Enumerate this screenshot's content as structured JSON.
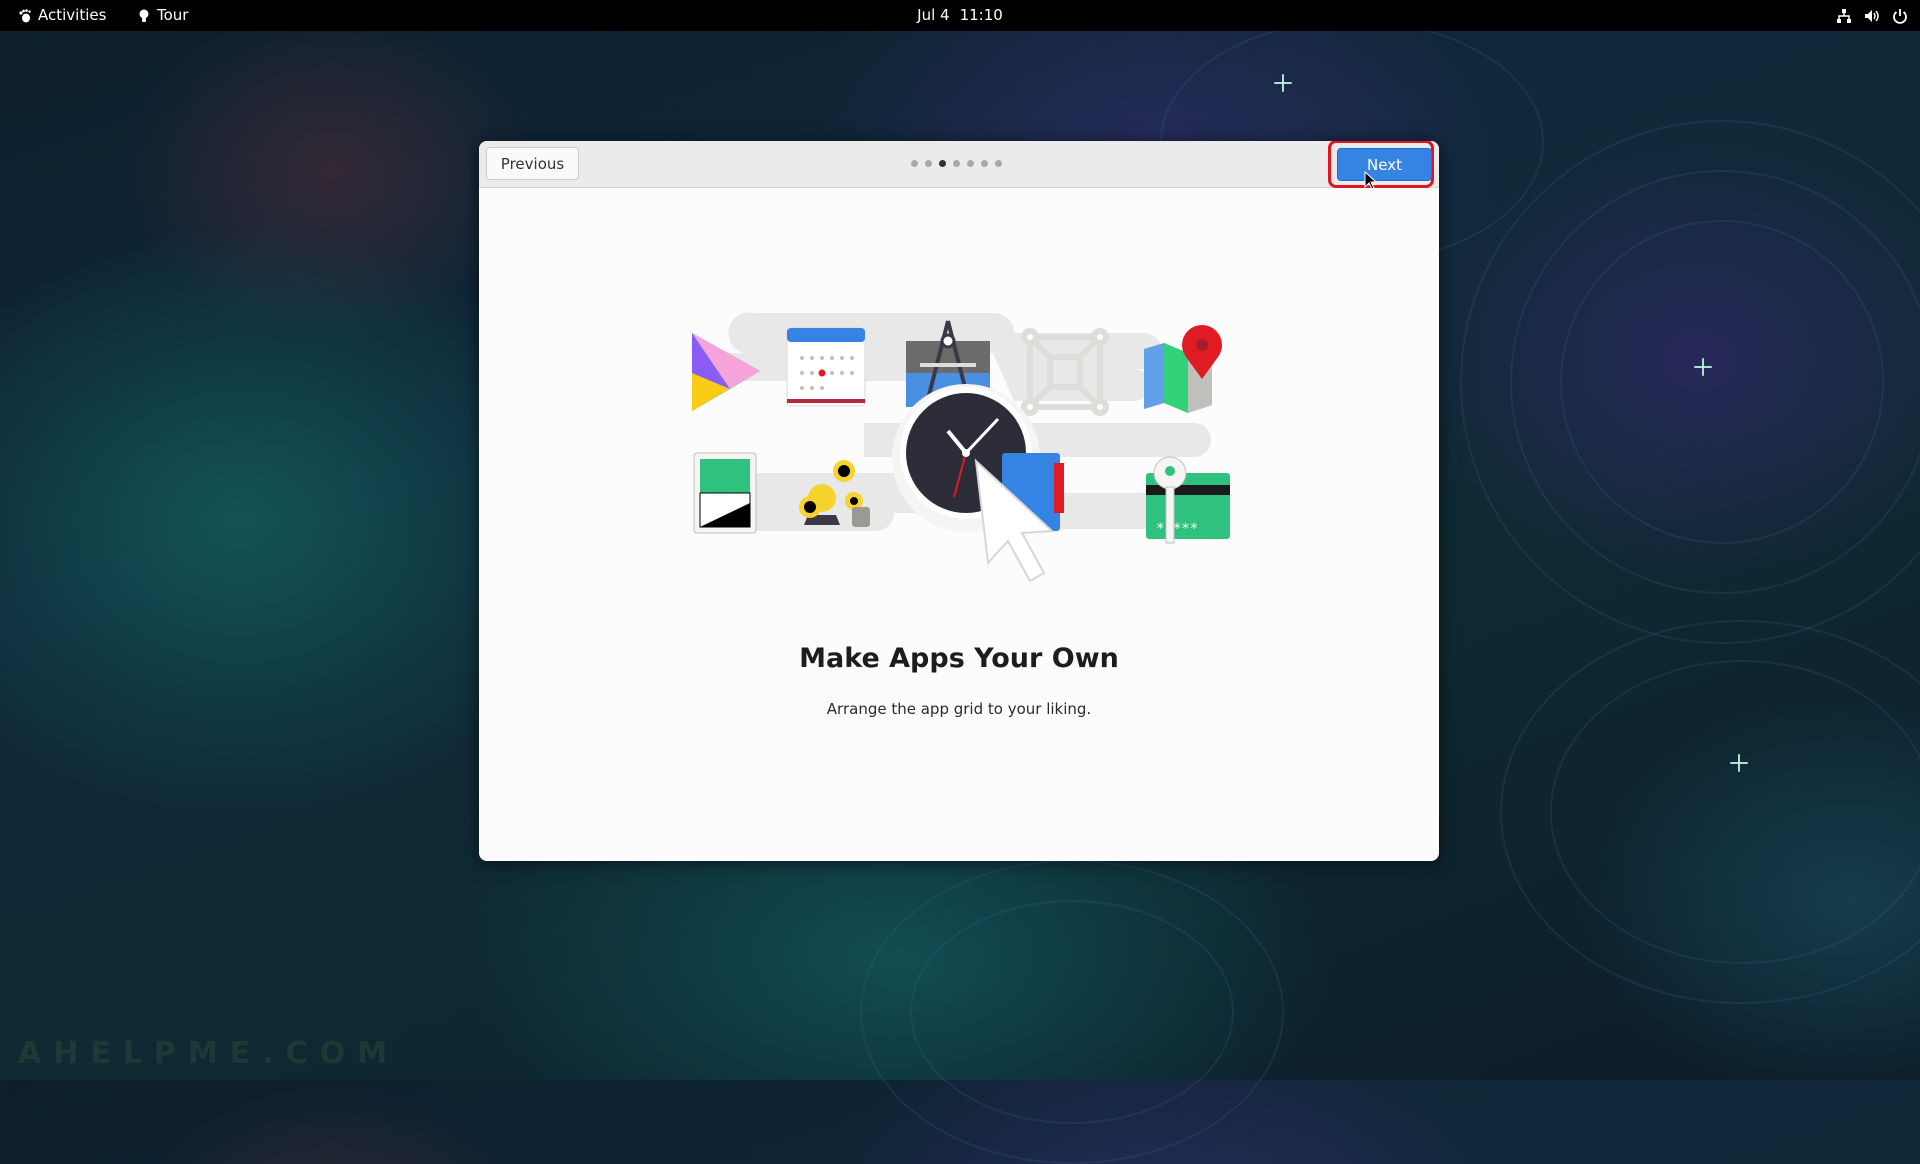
{
  "topbar": {
    "activities_label": "Activities",
    "tour_label": "Tour",
    "date": "Jul 4",
    "time": "11:10",
    "tray_icons": [
      "network-icon",
      "volume-icon",
      "power-icon"
    ]
  },
  "tour": {
    "previous_label": "Previous",
    "next_label": "Next",
    "page_count": 7,
    "current_page": 3,
    "title": "Make Apps Your Own",
    "subtitle": "Arrange the app grid to your liking.",
    "highlight_color": "#e3141e",
    "accent_color": "#3584e4"
  },
  "watermark": "AHELPME.COM"
}
